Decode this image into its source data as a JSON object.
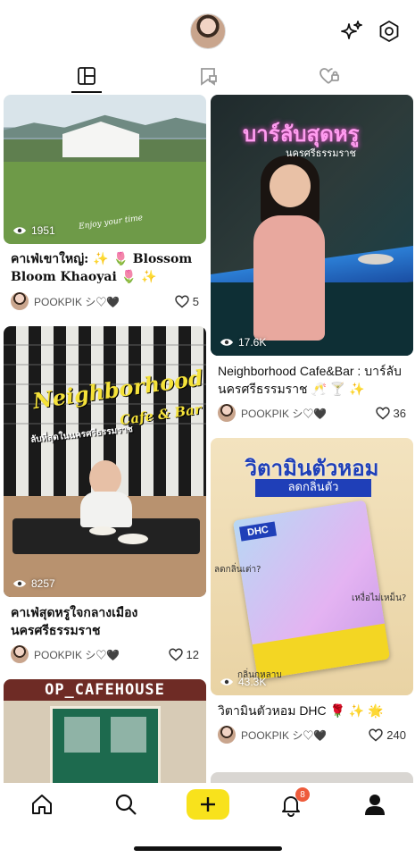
{
  "header": {
    "avatar": "profile-avatar",
    "sparkle_icon": "sparkles-icon",
    "settings_icon": "hexagon-settings-icon"
  },
  "tabs": [
    {
      "icon": "grid-layout-icon",
      "active": true
    },
    {
      "icon": "bookmark-flag-icon",
      "active": false
    },
    {
      "icon": "heart-lock-icon",
      "active": false
    }
  ],
  "posts": [
    {
      "views": "1951",
      "image_text": "Enjoy your time",
      "title": "คาเฟ่เขาใหญ่: ✨ 🌷 Blossom Bloom Khaoyai 🌷 ✨",
      "author": "POOKPIK シ♡🖤",
      "likes": "5"
    },
    {
      "views": "17.6K",
      "image_text": "บาร์ลับสุดหรู",
      "image_subtext": "นครศรีธรรมราช",
      "title": "Neighborhood Cafe&Bar : บาร์ลับนครศรีธรรมราช 🥂 🍸 ✨",
      "author": "POOKPIK シ♡🖤",
      "likes": "36"
    },
    {
      "views": "8257",
      "image_text": "Neighborhood",
      "image_subtext": "Cafe & Bar",
      "image_subtext2": "ลับที่สุดในนครศรีธรรมราช",
      "title": "คาเฟ่สุดหรูใจกลางเมือง นครศรีธรรมราช",
      "author": "POOKPIK シ♡🖤",
      "likes": "12"
    },
    {
      "views": "43.3K",
      "image_text": "วิตามินตัวหอม",
      "image_subtext": "ลดกลิ่นตัว",
      "image_notes": [
        "ลดกลิ่นเต่า?",
        "เหงื่อไม่เหม็น?",
        "กลิ่นกุหลาบ"
      ],
      "image_product": "DHC",
      "title": "วิตามินตัวหอม DHC 🌹 ✨ 🌟",
      "author": "POOKPIK シ♡🖤",
      "likes": "240"
    },
    {
      "image_text": "OP_CAFEHOUSE"
    }
  ],
  "nav": {
    "items": [
      "home-icon",
      "search-icon",
      "add-icon",
      "bell-icon",
      "profile-icon"
    ],
    "notification_count": "8"
  },
  "colors": {
    "accent": "#f8e21c",
    "badge": "#ee5b3b"
  }
}
